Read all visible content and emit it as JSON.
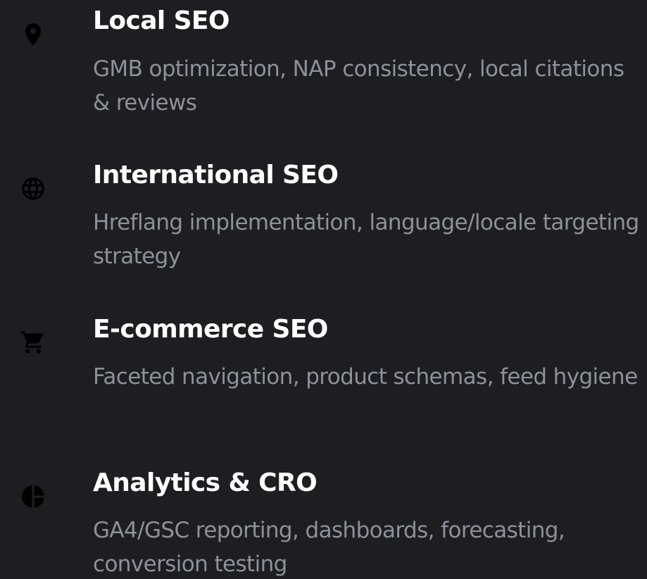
{
  "services": [
    {
      "icon": "map-pin-icon",
      "title": "Local SEO",
      "description": "GMB optimization, NAP consistency, local citations & reviews"
    },
    {
      "icon": "globe-icon",
      "title": "International SEO",
      "description": "Hreflang implementation, language/locale targeting strategy"
    },
    {
      "icon": "shopping-cart-icon",
      "title": "E-commerce SEO",
      "description": "Faceted navigation, product schemas, feed hygiene"
    },
    {
      "icon": "pie-chart-icon",
      "title": "Analytics & CRO",
      "description": "GA4/GSC reporting, dashboards, forecasting, conversion testing"
    }
  ],
  "colors": {
    "background": "#1c1e22",
    "title": "#ffffff",
    "description": "#8d919a",
    "icon": "#000000"
  }
}
